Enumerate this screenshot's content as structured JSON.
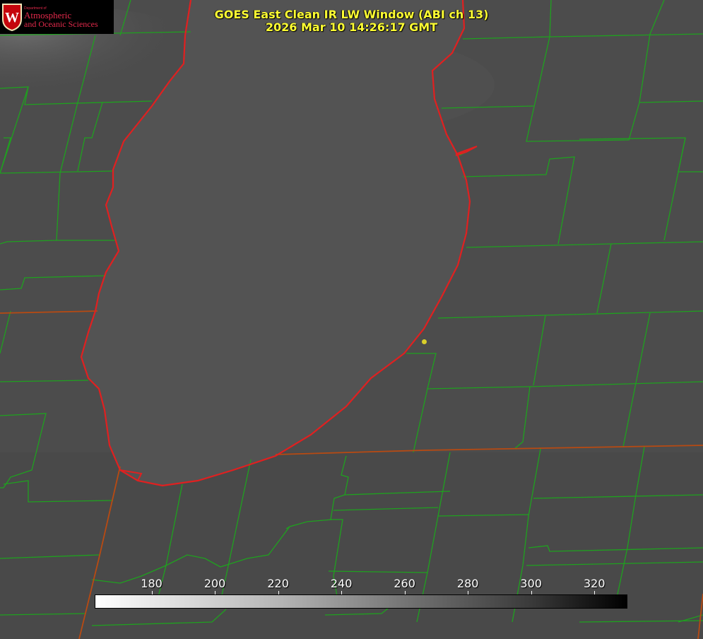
{
  "title": {
    "line1": "GOES East Clean IR LW Window (ABI ch 13)",
    "line2": "2026 Mar 10 14:26:17 GMT"
  },
  "logo": {
    "dept": "Department of",
    "line1": "Atmospheric",
    "line2": "and Oceanic Sciences",
    "seal_letter": "W",
    "color": "#e3294b"
  },
  "colorbar": {
    "ticks": [
      "180",
      "200",
      "220",
      "240",
      "260",
      "280",
      "300",
      "320"
    ],
    "min_value": 162,
    "max_value": 330,
    "gradient": "white-to-black"
  },
  "colors": {
    "background": "#4a4a4a",
    "county_lines": "#1fa11f",
    "lake_shore": "#e02020",
    "state_lines": "#b84a12",
    "title": "#ffff33",
    "city_marker": "#d9cf2a"
  },
  "map_features": {
    "water_body": "lake",
    "city_marker": "city-dot"
  }
}
